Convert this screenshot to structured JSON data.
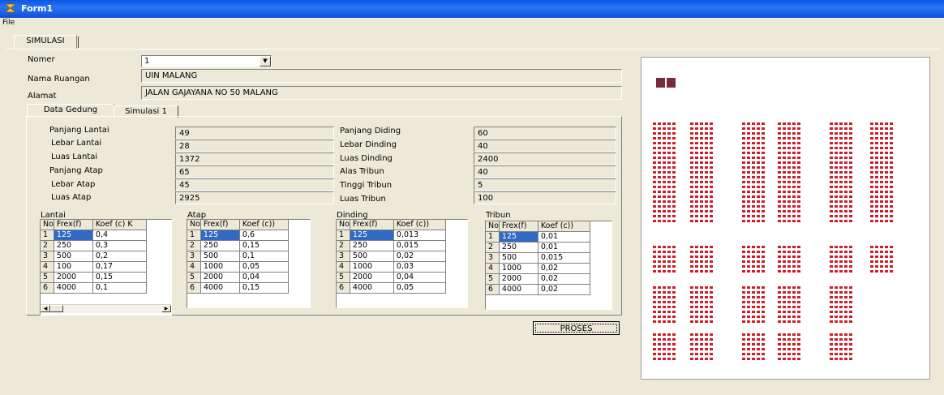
{
  "window": {
    "title": "Form1"
  },
  "menu": {
    "file": "File"
  },
  "tabs": {
    "main": "SIMULASI",
    "data_gedung": "Data Gedung",
    "simulasi1": "Simulasi 1"
  },
  "form": {
    "nomer_label": "Nomer",
    "nomer_value": "1",
    "nama_label": "Nama Ruangan",
    "nama_value": "UIN MALANG",
    "alamat_label": "Alamat",
    "alamat_value": "JALAN GAJAYANA NO 50 MALANG"
  },
  "gedung": {
    "left": [
      {
        "label": "Panjang Lantai",
        "value": "49"
      },
      {
        "label": "Lebar Lantai",
        "value": "28"
      },
      {
        "label": "Luas Lantai",
        "value": "1372"
      },
      {
        "label": "Panjang Atap",
        "value": "65"
      },
      {
        "label": "Lebar Atap",
        "value": "45"
      },
      {
        "label": "Luas Atap",
        "value": "2925"
      }
    ],
    "right": [
      {
        "label": "Panjang Diding",
        "value": "60"
      },
      {
        "label": "Lebar Dinding",
        "value": "40"
      },
      {
        "label": "Luas Dinding",
        "value": "2400"
      },
      {
        "label": "Alas Tribun",
        "value": "40"
      },
      {
        "label": "Tinggi Tribun",
        "value": "5"
      },
      {
        "label": "Luas Tribun",
        "value": "100"
      }
    ]
  },
  "tables": {
    "lantai": {
      "title": "Lantai",
      "headers": [
        "No",
        "Frex(f)",
        "Koef (c) K"
      ],
      "rows": [
        [
          "1",
          "125",
          "0,4"
        ],
        [
          "2",
          "250",
          "0,3"
        ],
        [
          "3",
          "500",
          "0,2"
        ],
        [
          "4",
          "100",
          "0,17"
        ],
        [
          "5",
          "2000",
          "0,15"
        ],
        [
          "6",
          "4000",
          "0,1"
        ]
      ]
    },
    "atap": {
      "title": "Atap",
      "headers": [
        "No",
        "Frex(f)",
        "Koef (c))"
      ],
      "rows": [
        [
          "1",
          "125",
          "0,6"
        ],
        [
          "2",
          "250",
          "0,15"
        ],
        [
          "3",
          "500",
          "0,1"
        ],
        [
          "4",
          "1000",
          "0,05"
        ],
        [
          "5",
          "2000",
          "0,04"
        ],
        [
          "6",
          "4000",
          "0,15"
        ]
      ]
    },
    "dinding": {
      "title": "Dinding",
      "headers": [
        "No",
        "Frex(f)",
        "Koef (c))"
      ],
      "rows": [
        [
          "1",
          "125",
          "0,013"
        ],
        [
          "2",
          "250",
          "0,015"
        ],
        [
          "3",
          "500",
          "0,02"
        ],
        [
          "4",
          "1000",
          "0,03"
        ],
        [
          "5",
          "2000",
          "0,04"
        ],
        [
          "6",
          "4000",
          "0,05"
        ]
      ]
    },
    "tribun": {
      "title": "Tribun",
      "headers": [
        "No",
        "Frex(f)",
        "Koef (c))"
      ],
      "rows": [
        [
          "1",
          "125",
          "0,01"
        ],
        [
          "2",
          "250",
          "0,01"
        ],
        [
          "3",
          "500",
          "0,015"
        ],
        [
          "4",
          "1000",
          "0,02"
        ],
        [
          "5",
          "2000",
          "0,02"
        ],
        [
          "6",
          "4000",
          "0,02"
        ]
      ]
    }
  },
  "buttons": {
    "proses": "PROSES"
  },
  "colors": {
    "titlebar": "#0a56e6",
    "selection": "#316ac5",
    "seat": "#cc1f2a",
    "face": "#ece9d8"
  }
}
